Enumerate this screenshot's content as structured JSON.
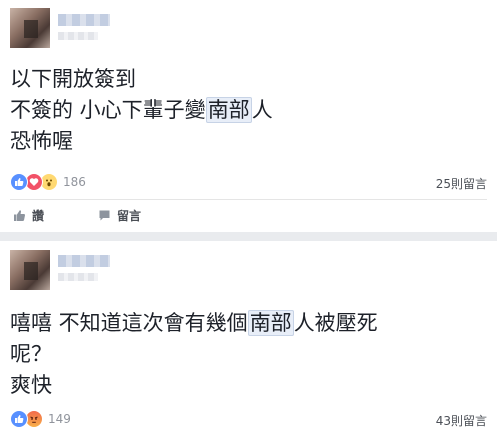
{
  "colors": {
    "page_bg": "#e9ebee",
    "card_bg": "#ffffff",
    "text": "#1d2129",
    "meta": "#90949c",
    "highlight_bg": "#e8eef8",
    "like": "#5890ff",
    "love": "#f25268",
    "wow": "#ffd972",
    "angry": "#f26a4b"
  },
  "posts": [
    {
      "lines": [
        {
          "before": "以下開放簽到",
          "highlight": "",
          "after": ""
        },
        {
          "before": "不簽的 小心下輩子變",
          "highlight": "南部",
          "after": "人"
        },
        {
          "before": "恐怖喔",
          "highlight": "",
          "after": ""
        }
      ],
      "reactions": {
        "icons": [
          "like-icon",
          "love-icon",
          "wow-icon"
        ],
        "count": "186"
      },
      "comments_count": "25則留言"
    },
    {
      "lines": [
        {
          "before": "嘻嘻 不知道這次會有幾個",
          "highlight": "南部",
          "after": "人被壓死"
        },
        {
          "before": "呢？",
          "highlight": "",
          "after": ""
        },
        {
          "before": "爽快",
          "highlight": "",
          "after": ""
        }
      ],
      "reactions": {
        "icons": [
          "like-icon",
          "angry-icon"
        ],
        "count": "149"
      },
      "comments_count": "43則留言"
    }
  ],
  "actions": {
    "like_label": "讚",
    "comment_label": "留言"
  }
}
